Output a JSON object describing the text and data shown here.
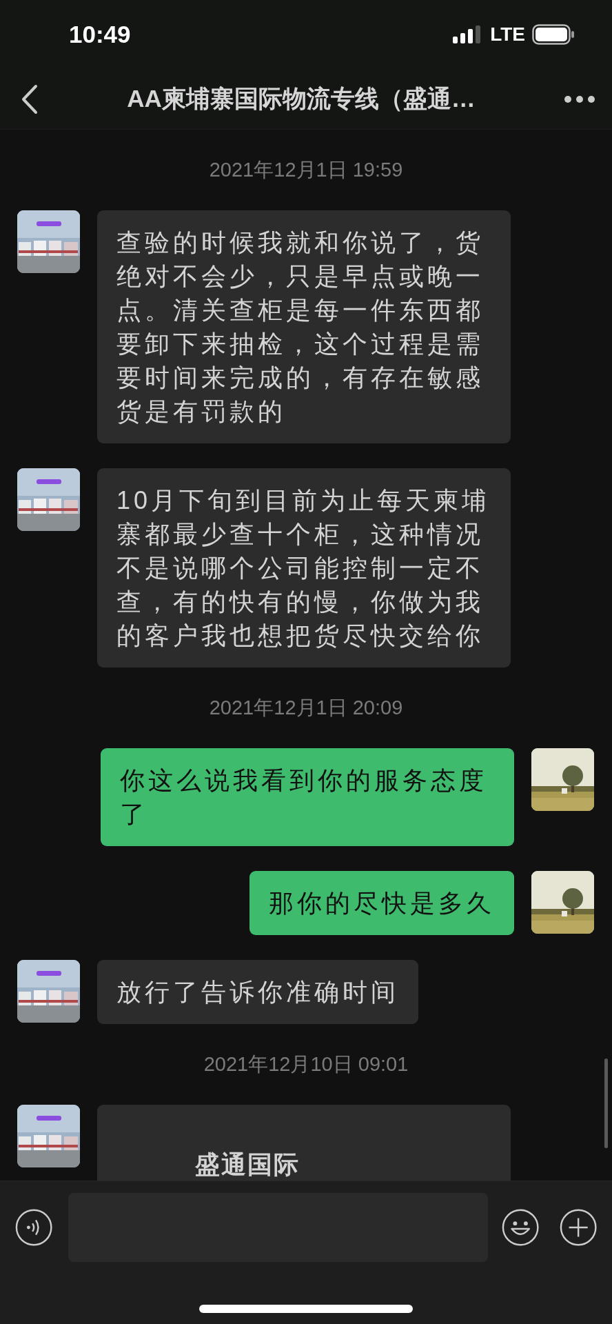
{
  "status_bar": {
    "time": "10:49",
    "network": "LTE"
  },
  "header": {
    "title": "AA柬埔寨国际物流专线（盛通…"
  },
  "messages": [
    {
      "kind": "timestamp",
      "text": "2021年12月1日 19:59"
    },
    {
      "kind": "text",
      "outgoing": false,
      "text": "查验的时候我就和你说了，货绝对不会少，只是早点或晚一点。清关查柜是每一件东西都要卸下来抽检，这个过程是需要时间来完成的，有存在敏感货是有罚款的"
    },
    {
      "kind": "text",
      "outgoing": false,
      "text": "10月下旬到目前为止每天柬埔寨都最少查十个柜，这种情况不是说哪个公司能控制一定不查，有的快有的慢，你做为我的客户我也想把货尽快交给你"
    },
    {
      "kind": "timestamp",
      "text": "2021年12月1日 20:09"
    },
    {
      "kind": "text",
      "outgoing": true,
      "text": "你这么说我看到你的服务态度了"
    },
    {
      "kind": "text",
      "outgoing": true,
      "text": "那你的尽快是多久"
    },
    {
      "kind": "text",
      "outgoing": false,
      "text": "放行了告诉你准确时间"
    },
    {
      "kind": "timestamp",
      "text": "2021年12月10日 09:01"
    },
    {
      "kind": "card",
      "outgoing": false,
      "text": "盛通国际"
    }
  ]
}
